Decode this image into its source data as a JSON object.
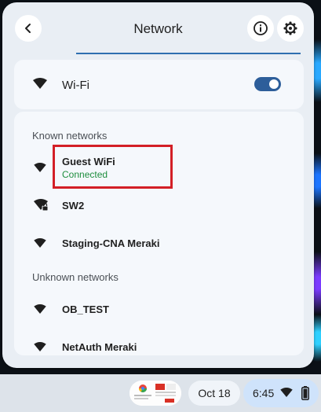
{
  "header": {
    "title": "Network"
  },
  "wifi": {
    "label": "Wi-Fi",
    "enabled": true
  },
  "known": {
    "label": "Known networks",
    "items": [
      {
        "name": "Guest WiFi",
        "status": "Connected"
      },
      {
        "name": "SW2",
        "locked": true
      },
      {
        "name": "Staging-CNA Meraki"
      }
    ]
  },
  "unknown": {
    "label": "Unknown networks",
    "items": [
      {
        "name": "OB_TEST"
      },
      {
        "name": "NetAuth Meraki"
      }
    ]
  },
  "shelf": {
    "date": "Oct 18",
    "time": "6:45"
  },
  "colors": {
    "accent": "#2d5e9a",
    "connected": "#1e8e3e",
    "highlight": "#d31f26"
  }
}
